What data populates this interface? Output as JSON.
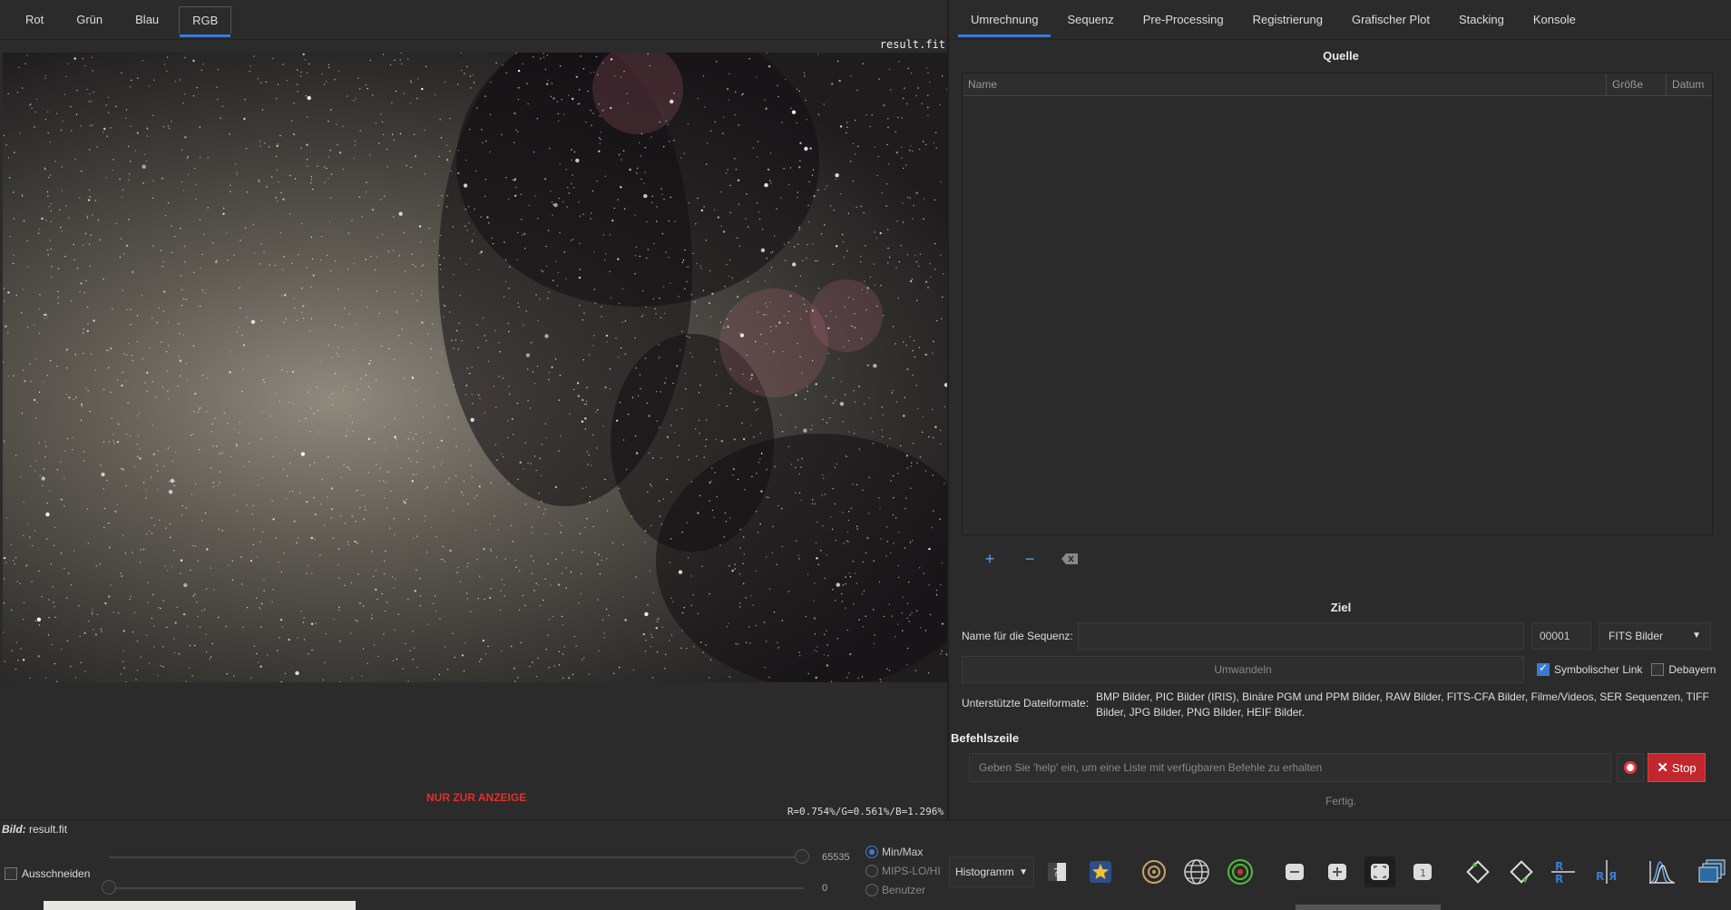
{
  "left_tabs": [
    "Rot",
    "Grün",
    "Blau",
    "RGB"
  ],
  "left_active_tab": "RGB",
  "image_filename": "result.fit",
  "display_only_label": "NUR ZUR ANZEIGE",
  "rgb_readout": "R=0.754%/G=0.561%/B=1.296%",
  "right_tabs": [
    "Umrechnung",
    "Sequenz",
    "Pre-Processing",
    "Registrierung",
    "Grafischer Plot",
    "Stacking",
    "Konsole"
  ],
  "right_active_tab": "Umrechnung",
  "source": {
    "title": "Quelle",
    "columns": [
      "Name",
      "Größe",
      "Datum"
    ]
  },
  "target": {
    "title": "Ziel",
    "sequence_name_label": "Name für die Sequenz:",
    "sequence_name_value": "",
    "start_index": "00001",
    "output_format": "FITS Bilder",
    "convert_button": "Umwandeln",
    "symlink_label": "Symbolischer Link",
    "symlink_checked": true,
    "debayer_label": "Debayern",
    "debayer_checked": false,
    "formats_label": "Unterstützte Dateiformate:",
    "formats_text": "BMP Bilder, PIC Bilder (IRIS), Binäre PGM und PPM Bilder, RAW Bilder, FITS-CFA Bilder, Filme/Videos, SER Sequenzen, TIFF Bilder, JPG Bilder, PNG Bilder, HEIF Bilder."
  },
  "command": {
    "title": "Befehlszeile",
    "placeholder": "Geben Sie 'help' ein, um eine Liste mit verfügbaren Befehle zu erhalten",
    "stop_label": "Stop",
    "status": "Fertig."
  },
  "bottom": {
    "bild_label": "Bild:",
    "bild_value": "result.fit",
    "cut_label": "Ausschneiden",
    "hi_value": "65535",
    "lo_value": "0",
    "modes": [
      "Min/Max",
      "MIPS-LO/HI",
      "Benutzer"
    ],
    "selected_mode": "Min/Max",
    "display_mode": "Histogramm"
  },
  "colors": {
    "accent": "#3a7bd5",
    "alert": "#e0302c",
    "stop": "#c2262e"
  }
}
